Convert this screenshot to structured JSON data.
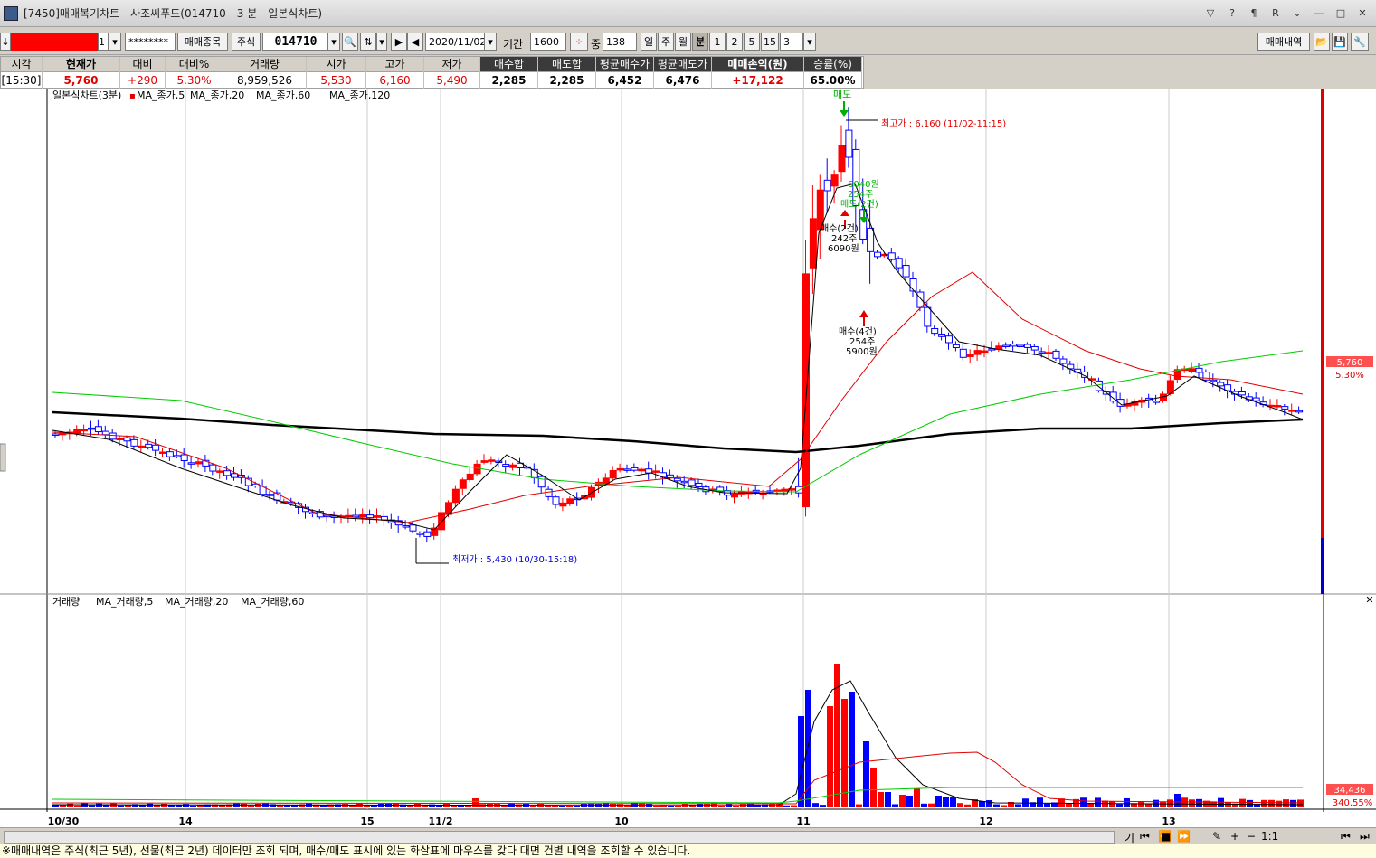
{
  "window": {
    "title": "[7450]매매복기차트 - 사조씨푸드(014710 - 3 분 - 일본식차트)",
    "controls": [
      "▽",
      "?",
      "¶",
      "R",
      "⌄",
      "—",
      "□",
      "✕"
    ]
  },
  "toolbar": {
    "account_suffix": "1",
    "password_mask": "********",
    "trade_items_button": "매매종목",
    "market_label": "주식",
    "stock_code": "014710",
    "date": "2020/11/02",
    "period_label": "기간",
    "period_value": "1600",
    "count_label": "중",
    "count_value": "138",
    "period_buttons": [
      "일",
      "주",
      "월",
      "분",
      "1",
      "2",
      "5",
      "15",
      "3"
    ],
    "trade_history_button": "매매내역"
  },
  "quotes": {
    "headers": [
      "시각",
      "현재가",
      "대비",
      "대비%",
      "거래량",
      "시가",
      "고가",
      "저가",
      "매수합",
      "매도합",
      "평균매수가",
      "평균매도가",
      "매매손익(원)",
      "승률(%)"
    ],
    "values": [
      "[15:30]",
      "5,760",
      "+290",
      "5.30%",
      "8,959,526",
      "5,530",
      "6,160",
      "5,490",
      "2,285",
      "2,285",
      "6,452",
      "6,476",
      "+17,122",
      "65.00%"
    ]
  },
  "price_panel": {
    "legend": "일본식차트(3분)",
    "ma_labels": [
      "MA_종가,5",
      "MA_종가,20",
      "MA_종가,60",
      "MA_종가,120"
    ],
    "annotations": {
      "sell_top": "매도",
      "high": "최고가 : 6,160 (11/02-11:15)",
      "low": "최저가 : 5,430 (10/30-15:18)",
      "sell_mid_lines": [
        "6040원",
        "254주",
        "매도(2건)"
      ],
      "buy_mid_lines": [
        "매수(2건)",
        "242주",
        "6090원"
      ],
      "buy_low_lines": [
        "매수(4건)",
        "254주",
        "5900원"
      ]
    },
    "price_label": "5,760",
    "pct_label": "5.30%"
  },
  "volume_panel": {
    "legend": "거래량",
    "ma_labels": [
      "MA_거래량,5",
      "MA_거래량,20",
      "MA_거래량,60"
    ],
    "vol_label": "34,436",
    "vol_pct": "340.55%"
  },
  "x_axis": [
    "10/30",
    "14",
    "15",
    "11/2",
    "10",
    "11",
    "12",
    "13"
  ],
  "navbar": {
    "items": [
      "기",
      "⏮",
      "⏪",
      "■",
      "⏩",
      "✎",
      "+",
      "−",
      "1:1",
      "⏮",
      "⏭"
    ]
  },
  "status": "※매매내역은 주식(최근 5년), 선물(최근 2년) 데이터만 조회 되며, 매수/매도 표시에 있는 화살표에 마우스를 갖다 대면 건별 내역을 조회할 수 있습니다.",
  "colors": {
    "up": "#ff0000",
    "down": "#0000ff",
    "ma5": "#000000",
    "ma20": "#e00000",
    "ma60": "#00c000",
    "ma120": "#000000"
  }
}
